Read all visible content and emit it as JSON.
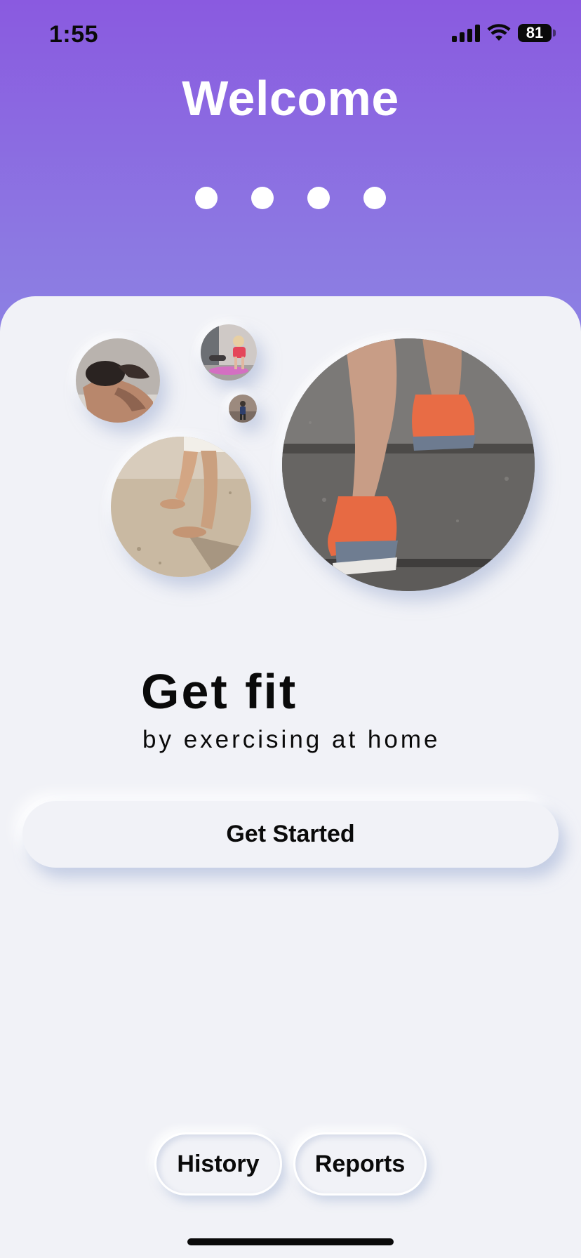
{
  "status_bar": {
    "time": "1:55",
    "battery_level": "81",
    "icons": [
      "cellular-signal-icon",
      "wifi-icon",
      "battery-icon"
    ]
  },
  "header": {
    "title": "Welcome",
    "page_indicator": {
      "count": 4
    }
  },
  "hero": {
    "images": [
      {
        "name": "photo-man-stretching",
        "subject": "man stretching arms behind head"
      },
      {
        "name": "photo-woman-yoga",
        "subject": "woman in pink top on yoga mat"
      },
      {
        "name": "photo-small-person",
        "subject": "person standing outdoors"
      },
      {
        "name": "photo-pushup-sand",
        "subject": "hands doing push-up on sand"
      },
      {
        "name": "photo-running-stairs",
        "subject": "legs in orange running shoes on stone stairs"
      }
    ]
  },
  "content": {
    "headline": "Get fit",
    "subline": "by exercising at home",
    "cta_label": "Get Started"
  },
  "footer": {
    "history_label": "History",
    "reports_label": "Reports"
  },
  "colors": {
    "header_gradient_top": "#8a5ae0",
    "header_gradient_bottom": "#8c84e4",
    "sheet_background": "#f1f2f7",
    "text": "#0a0a0a",
    "title_text": "#ffffff"
  }
}
